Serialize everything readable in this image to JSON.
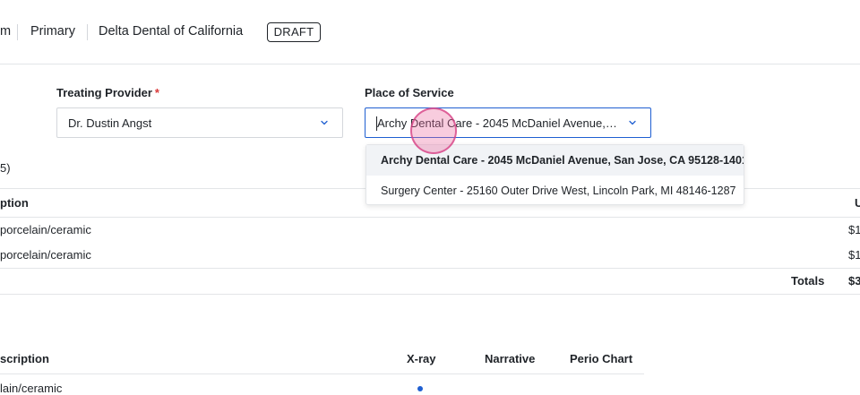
{
  "header": {
    "crumbs": [
      "m",
      "Primary",
      "Delta Dental of California"
    ],
    "status_badge": "DRAFT"
  },
  "form": {
    "treating_provider": {
      "label": "Treating Provider",
      "required_mark": "*",
      "value": "Dr. Dustin Angst"
    },
    "place_of_service": {
      "label": "Place of Service",
      "value": "Archy Dental Care - 2045 McDaniel Avenue, Sa...",
      "options": [
        "Archy Dental Care - 2045 McDaniel Avenue, San Jose, CA 95128-1401",
        "Surgery Center - 25160 Outer Drive West, Lincoln Park, MI 48146-1287"
      ],
      "selected_index": 0
    }
  },
  "procedures": {
    "count_text": "5)",
    "header_description": "ption",
    "header_right": "U",
    "rows": [
      {
        "description": "porcelain/ceramic",
        "amount": "$1"
      },
      {
        "description": "porcelain/ceramic",
        "amount": "$1"
      }
    ],
    "totals_label": "Totals",
    "totals_value": "$3"
  },
  "attachments": {
    "headers": {
      "description": "scription",
      "xray": "X-ray",
      "narrative": "Narrative",
      "perio_chart": "Perio Chart"
    },
    "rows": [
      {
        "description": "lain/ceramic",
        "xray_attached": true
      }
    ]
  },
  "colors": {
    "accent": "#1f5fd1",
    "required": "#d93a3a",
    "border": "#e3e5e8"
  }
}
